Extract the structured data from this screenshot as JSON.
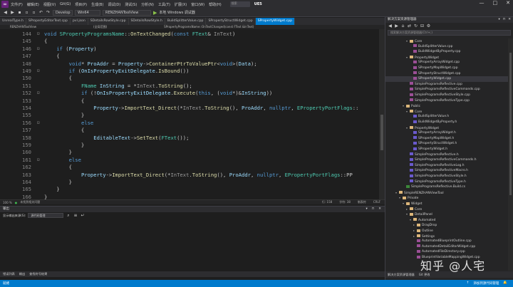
{
  "titlebar": {
    "menu": [
      "文件(F)",
      "编辑(E)",
      "视图(V)",
      "Git(G)",
      "项目(P)",
      "生成(B)",
      "调试(D)",
      "测试(S)",
      "分析(N)",
      "工具(T)",
      "扩展(X)",
      "窗口(W)",
      "帮助(H)"
    ],
    "search": "搜索",
    "solution": "UE5",
    "window_buttons": [
      "—",
      "□",
      "✕"
    ]
  },
  "toolbar": {
    "config": "Develop",
    "platform": "Win64",
    "startup_project": "RENZHANToolView",
    "run_label": "本地 Windows 调试器"
  },
  "tabs": [
    "UnrealType.h",
    "SPropertyEditorText.cpp",
    "pvl.json",
    "SDetailsRowStyle.cpp",
    "SDetailsRowStyle.h",
    "BuildSplitterValue.cpp",
    "SPropertyStructWidget.cpp",
    "SPropertyWidget.cpp"
  ],
  "navbar": {
    "project": "RENZHANToolView",
    "scope": "(全局范围)",
    "member": "SPropertyProgramsName::OnTextChanged(const FText &InText)"
  },
  "editor": {
    "lines": [
      {
        "n": "144",
        "tokens": [
          [
            "kw",
            "void "
          ],
          [
            "ty",
            "SPropertyProgramsName"
          ],
          [
            "id",
            "::"
          ],
          [
            "fn",
            "OnTextChanged"
          ],
          [
            "id",
            "("
          ],
          [
            "kw",
            "const "
          ],
          [
            "ty",
            "FText"
          ],
          [
            "id",
            "& "
          ],
          [
            "pm",
            "InText"
          ],
          [
            "id",
            ")"
          ]
        ]
      },
      {
        "n": "145",
        "tokens": [
          [
            "id",
            "{"
          ]
        ]
      },
      {
        "n": "146",
        "tokens": [
          [
            "id",
            "    "
          ],
          [
            "kw",
            "if "
          ],
          [
            "id",
            "("
          ],
          [
            "va",
            "Property"
          ],
          [
            "id",
            ")"
          ]
        ]
      },
      {
        "n": "147",
        "tokens": [
          [
            "id",
            "    {"
          ]
        ]
      },
      {
        "n": "148",
        "tokens": [
          [
            "id",
            "        "
          ],
          [
            "kw",
            "void"
          ],
          [
            "id",
            "* "
          ],
          [
            "va",
            "ProAddr"
          ],
          [
            "id",
            " = "
          ],
          [
            "va",
            "Property"
          ],
          [
            "id",
            "->"
          ],
          [
            "fn",
            "ContainerPtrToValuePtr"
          ],
          [
            "id",
            "<"
          ],
          [
            "kw",
            "void"
          ],
          [
            "id",
            ">("
          ],
          [
            "va",
            "Data"
          ],
          [
            "id",
            ");"
          ]
        ]
      },
      {
        "n": "149",
        "tokens": [
          [
            "id",
            "        "
          ],
          [
            "kw",
            "if "
          ],
          [
            "id",
            "("
          ],
          [
            "va",
            "OnIsPropertyExitDelegate"
          ],
          [
            "id",
            "."
          ],
          [
            "fn",
            "IsBound"
          ],
          [
            "id",
            "())"
          ]
        ]
      },
      {
        "n": "150",
        "tokens": [
          [
            "id",
            "        {"
          ]
        ]
      },
      {
        "n": "151",
        "tokens": [
          [
            "id",
            "            "
          ],
          [
            "ty",
            "FName "
          ],
          [
            "va",
            "InString"
          ],
          [
            "id",
            " = *"
          ],
          [
            "pm",
            "InText"
          ],
          [
            "id",
            "."
          ],
          [
            "fn",
            "ToString"
          ],
          [
            "id",
            "();"
          ]
        ]
      },
      {
        "n": "152",
        "tokens": [
          [
            "id",
            "            "
          ],
          [
            "kw",
            "if "
          ],
          [
            "id",
            "(!"
          ],
          [
            "va",
            "OnIsPropertyExitDelegate"
          ],
          [
            "id",
            "."
          ],
          [
            "fn",
            "Execute"
          ],
          [
            "id",
            "("
          ],
          [
            "kw",
            "this"
          ],
          [
            "id",
            ", ("
          ],
          [
            "kw",
            "void"
          ],
          [
            "id",
            "*)&"
          ],
          [
            "va",
            "InString"
          ],
          [
            "id",
            "))"
          ]
        ]
      },
      {
        "n": "153",
        "tokens": [
          [
            "id",
            "            {"
          ]
        ]
      },
      {
        "n": "154",
        "tokens": [
          [
            "id",
            "                "
          ],
          [
            "va",
            "Property"
          ],
          [
            "id",
            "->"
          ],
          [
            "fn",
            "ImportText_Direct"
          ],
          [
            "id",
            "(*"
          ],
          [
            "pm",
            "InText"
          ],
          [
            "id",
            "."
          ],
          [
            "fn",
            "ToString"
          ],
          [
            "id",
            "(), "
          ],
          [
            "va",
            "ProAddr"
          ],
          [
            "id",
            ", "
          ],
          [
            "kw",
            "nullptr"
          ],
          [
            "id",
            ", "
          ],
          [
            "ty",
            "EPropertyPortFlags"
          ],
          [
            "id",
            "::"
          ]
        ]
      },
      {
        "n": "155",
        "tokens": [
          [
            "id",
            "            }"
          ]
        ]
      },
      {
        "n": "156",
        "tokens": [
          [
            "id",
            "            "
          ],
          [
            "kw",
            "else"
          ]
        ]
      },
      {
        "n": "157",
        "tokens": [
          [
            "id",
            "            {"
          ]
        ]
      },
      {
        "n": "158",
        "tokens": [
          [
            "id",
            "                "
          ],
          [
            "va",
            "EditableText"
          ],
          [
            "id",
            "->"
          ],
          [
            "fn",
            "SetText"
          ],
          [
            "id",
            "("
          ],
          [
            "ty",
            "FText"
          ],
          [
            "id",
            "());"
          ]
        ]
      },
      {
        "n": "159",
        "tokens": [
          [
            "id",
            "            }"
          ]
        ]
      },
      {
        "n": "160",
        "tokens": [
          [
            "id",
            "        }"
          ]
        ]
      },
      {
        "n": "161",
        "tokens": [
          [
            "id",
            "        "
          ],
          [
            "kw",
            "else"
          ]
        ]
      },
      {
        "n": "162",
        "tokens": [
          [
            "id",
            "        {"
          ]
        ]
      },
      {
        "n": "163",
        "tokens": [
          [
            "id",
            "            "
          ],
          [
            "va",
            "Property"
          ],
          [
            "id",
            "->"
          ],
          [
            "fn",
            "ImportText_Direct"
          ],
          [
            "id",
            "(*"
          ],
          [
            "pm",
            "InText"
          ],
          [
            "id",
            "."
          ],
          [
            "fn",
            "ToString"
          ],
          [
            "id",
            "(), "
          ],
          [
            "va",
            "ProAddr"
          ],
          [
            "id",
            ", "
          ],
          [
            "kw",
            "nullptr"
          ],
          [
            "id",
            ", "
          ],
          [
            "ty",
            "EPropertyPortFlags"
          ],
          [
            "id",
            "::PP"
          ]
        ]
      },
      {
        "n": "164",
        "tokens": [
          [
            "id",
            "        }"
          ]
        ]
      },
      {
        "n": "165",
        "tokens": [
          [
            "id",
            "    }"
          ]
        ]
      },
      {
        "n": "166",
        "tokens": [
          [
            "id",
            "}"
          ]
        ]
      },
      {
        "n": "167",
        "tokens": []
      }
    ]
  },
  "editor_status": {
    "zoom": "100 %",
    "issues": "未找到相关问题",
    "line": "行: 158",
    "col": "字符: 38",
    "mode": "制表符",
    "eol": "CRLF"
  },
  "output": {
    "title": "输出",
    "source_label": "显示输出来源(S):",
    "source_value": "源代码管理"
  },
  "bottom_tabs": [
    "错误列表",
    "输出",
    "查找符号结果"
  ],
  "statusbar": {
    "left": "就绪",
    "right": "添加到源代码管理"
  },
  "solution": {
    "title": "解决方案资源管理器",
    "search_placeholder": "搜索解决方案资源管理器(Ctrl+;)",
    "items": [
      {
        "label": "Core",
        "depth": 5,
        "icon": "folder",
        "tw": "▾"
      },
      {
        "label": "BuildSplitterValue.cpp",
        "depth": 6,
        "icon": "cpp",
        "tw": ""
      },
      {
        "label": "BuildWidgetByProperty.cpp",
        "depth": 6,
        "icon": "cpp",
        "tw": ""
      },
      {
        "label": "PropertyWidget",
        "depth": 5,
        "icon": "folder",
        "tw": "▾"
      },
      {
        "label": "SPropertyArrayWidget.cpp",
        "depth": 6,
        "icon": "cpp",
        "tw": ""
      },
      {
        "label": "SPropertyMapWidget.cpp",
        "depth": 6,
        "icon": "cpp",
        "tw": ""
      },
      {
        "label": "SPropertyStructWidget.cpp",
        "depth": 6,
        "icon": "cpp",
        "tw": ""
      },
      {
        "label": "SPropertyWidget.cpp",
        "depth": 6,
        "icon": "cpp",
        "tw": "",
        "sel": true
      },
      {
        "label": "SimpleProgramsReflective.cpp",
        "depth": 5,
        "icon": "cpp",
        "tw": ""
      },
      {
        "label": "SimpleProgramsReflectiveCommands.cpp",
        "depth": 5,
        "icon": "cpp",
        "tw": ""
      },
      {
        "label": "SimpleProgramsReflectiveStyle.cpp",
        "depth": 5,
        "icon": "cpp",
        "tw": ""
      },
      {
        "label": "SimpleProgramsReflectiveType.cpp",
        "depth": 5,
        "icon": "cpp",
        "tw": ""
      },
      {
        "label": "Public",
        "depth": 4,
        "icon": "folder",
        "tw": "▾"
      },
      {
        "label": "Core",
        "depth": 5,
        "icon": "folder",
        "tw": "▾"
      },
      {
        "label": "BuildSplitterValue.h",
        "depth": 6,
        "icon": "h",
        "tw": ""
      },
      {
        "label": "BuildWidgetByProperty.h",
        "depth": 6,
        "icon": "h",
        "tw": ""
      },
      {
        "label": "PropertyWidget",
        "depth": 5,
        "icon": "folder",
        "tw": "▾"
      },
      {
        "label": "SPropertyArrayWidget.h",
        "depth": 6,
        "icon": "h",
        "tw": ""
      },
      {
        "label": "SPropertyMapWidget.h",
        "depth": 6,
        "icon": "h",
        "tw": ""
      },
      {
        "label": "SPropertyStructWidget.h",
        "depth": 6,
        "icon": "h",
        "tw": ""
      },
      {
        "label": "SPropertyWidget.h",
        "depth": 6,
        "icon": "h",
        "tw": ""
      },
      {
        "label": "SimpleProgramsReflective.h",
        "depth": 5,
        "icon": "h",
        "tw": ""
      },
      {
        "label": "SimpleProgramsReflectiveCommands.h",
        "depth": 5,
        "icon": "h",
        "tw": ""
      },
      {
        "label": "SimpleProgramsReflectiveLog.h",
        "depth": 5,
        "icon": "h",
        "tw": ""
      },
      {
        "label": "SimpleProgramsReflectiveMacro.h",
        "depth": 5,
        "icon": "h",
        "tw": ""
      },
      {
        "label": "SimpleProgramsReflectiveStyle.h",
        "depth": 5,
        "icon": "h",
        "tw": ""
      },
      {
        "label": "SimpleProgramsReflectiveType.h",
        "depth": 5,
        "icon": "h",
        "tw": ""
      },
      {
        "label": "SimpleProgramsReflective.Build.cs",
        "depth": 4,
        "icon": "cs",
        "tw": ""
      },
      {
        "label": "SimpleRENZHANViewTool",
        "depth": 2,
        "icon": "folder",
        "tw": "▾"
      },
      {
        "label": "Private",
        "depth": 3,
        "icon": "folder",
        "tw": "▾"
      },
      {
        "label": "Widget",
        "depth": 4,
        "icon": "folder",
        "tw": "▾"
      },
      {
        "label": "Core",
        "depth": 5,
        "icon": "folder",
        "tw": "▸"
      },
      {
        "label": "DetailPanel",
        "depth": 5,
        "icon": "folder",
        "tw": "▾"
      },
      {
        "label": "Automated",
        "depth": 6,
        "icon": "folder",
        "tw": "▾"
      },
      {
        "label": "DragDrop",
        "depth": 7,
        "icon": "folder",
        "tw": "▸"
      },
      {
        "label": "Outline",
        "depth": 7,
        "icon": "folder",
        "tw": "▸"
      },
      {
        "label": "Settings",
        "depth": 7,
        "icon": "folder",
        "tw": "▸"
      },
      {
        "label": "AutomatedBlueprintOutline.cpp",
        "depth": 7,
        "icon": "cpp",
        "tw": ""
      },
      {
        "label": "AutomatedDetailEditorWidget.cpp",
        "depth": 7,
        "icon": "cpp",
        "tw": ""
      },
      {
        "label": "AutomatedFileDirectory.cpp",
        "depth": 7,
        "icon": "cpp",
        "tw": ""
      },
      {
        "label": "BlueprintVariableMappingWidget.cpp",
        "depth": 7,
        "icon": "cpp",
        "tw": ""
      }
    ],
    "bottom_tabs": [
      "解决方案资源管理器",
      "Git 更改"
    ]
  },
  "watermark": "知乎 @人宅"
}
